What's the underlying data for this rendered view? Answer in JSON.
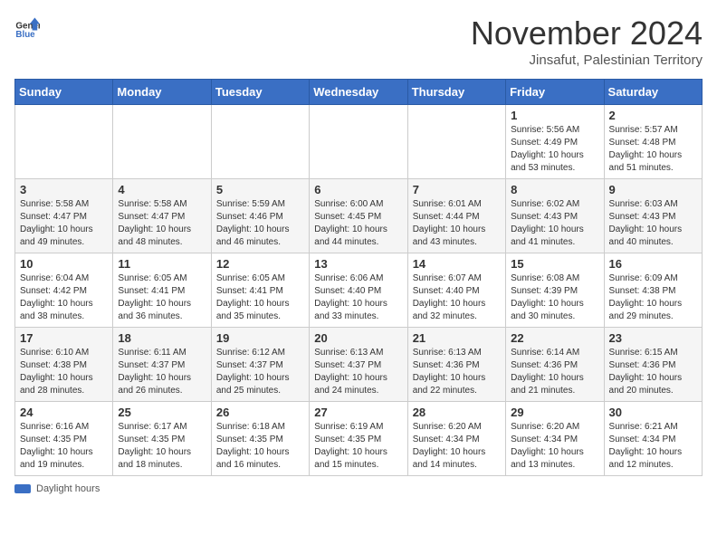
{
  "header": {
    "logo_general": "General",
    "logo_blue": "Blue",
    "month_title": "November 2024",
    "location": "Jinsafut, Palestinian Territory"
  },
  "days_of_week": [
    "Sunday",
    "Monday",
    "Tuesday",
    "Wednesday",
    "Thursday",
    "Friday",
    "Saturday"
  ],
  "weeks": [
    [
      {
        "day": "",
        "info": ""
      },
      {
        "day": "",
        "info": ""
      },
      {
        "day": "",
        "info": ""
      },
      {
        "day": "",
        "info": ""
      },
      {
        "day": "",
        "info": ""
      },
      {
        "day": "1",
        "info": "Sunrise: 5:56 AM\nSunset: 4:49 PM\nDaylight: 10 hours and 53 minutes."
      },
      {
        "day": "2",
        "info": "Sunrise: 5:57 AM\nSunset: 4:48 PM\nDaylight: 10 hours and 51 minutes."
      }
    ],
    [
      {
        "day": "3",
        "info": "Sunrise: 5:58 AM\nSunset: 4:47 PM\nDaylight: 10 hours and 49 minutes."
      },
      {
        "day": "4",
        "info": "Sunrise: 5:58 AM\nSunset: 4:47 PM\nDaylight: 10 hours and 48 minutes."
      },
      {
        "day": "5",
        "info": "Sunrise: 5:59 AM\nSunset: 4:46 PM\nDaylight: 10 hours and 46 minutes."
      },
      {
        "day": "6",
        "info": "Sunrise: 6:00 AM\nSunset: 4:45 PM\nDaylight: 10 hours and 44 minutes."
      },
      {
        "day": "7",
        "info": "Sunrise: 6:01 AM\nSunset: 4:44 PM\nDaylight: 10 hours and 43 minutes."
      },
      {
        "day": "8",
        "info": "Sunrise: 6:02 AM\nSunset: 4:43 PM\nDaylight: 10 hours and 41 minutes."
      },
      {
        "day": "9",
        "info": "Sunrise: 6:03 AM\nSunset: 4:43 PM\nDaylight: 10 hours and 40 minutes."
      }
    ],
    [
      {
        "day": "10",
        "info": "Sunrise: 6:04 AM\nSunset: 4:42 PM\nDaylight: 10 hours and 38 minutes."
      },
      {
        "day": "11",
        "info": "Sunrise: 6:05 AM\nSunset: 4:41 PM\nDaylight: 10 hours and 36 minutes."
      },
      {
        "day": "12",
        "info": "Sunrise: 6:05 AM\nSunset: 4:41 PM\nDaylight: 10 hours and 35 minutes."
      },
      {
        "day": "13",
        "info": "Sunrise: 6:06 AM\nSunset: 4:40 PM\nDaylight: 10 hours and 33 minutes."
      },
      {
        "day": "14",
        "info": "Sunrise: 6:07 AM\nSunset: 4:40 PM\nDaylight: 10 hours and 32 minutes."
      },
      {
        "day": "15",
        "info": "Sunrise: 6:08 AM\nSunset: 4:39 PM\nDaylight: 10 hours and 30 minutes."
      },
      {
        "day": "16",
        "info": "Sunrise: 6:09 AM\nSunset: 4:38 PM\nDaylight: 10 hours and 29 minutes."
      }
    ],
    [
      {
        "day": "17",
        "info": "Sunrise: 6:10 AM\nSunset: 4:38 PM\nDaylight: 10 hours and 28 minutes."
      },
      {
        "day": "18",
        "info": "Sunrise: 6:11 AM\nSunset: 4:37 PM\nDaylight: 10 hours and 26 minutes."
      },
      {
        "day": "19",
        "info": "Sunrise: 6:12 AM\nSunset: 4:37 PM\nDaylight: 10 hours and 25 minutes."
      },
      {
        "day": "20",
        "info": "Sunrise: 6:13 AM\nSunset: 4:37 PM\nDaylight: 10 hours and 24 minutes."
      },
      {
        "day": "21",
        "info": "Sunrise: 6:13 AM\nSunset: 4:36 PM\nDaylight: 10 hours and 22 minutes."
      },
      {
        "day": "22",
        "info": "Sunrise: 6:14 AM\nSunset: 4:36 PM\nDaylight: 10 hours and 21 minutes."
      },
      {
        "day": "23",
        "info": "Sunrise: 6:15 AM\nSunset: 4:36 PM\nDaylight: 10 hours and 20 minutes."
      }
    ],
    [
      {
        "day": "24",
        "info": "Sunrise: 6:16 AM\nSunset: 4:35 PM\nDaylight: 10 hours and 19 minutes."
      },
      {
        "day": "25",
        "info": "Sunrise: 6:17 AM\nSunset: 4:35 PM\nDaylight: 10 hours and 18 minutes."
      },
      {
        "day": "26",
        "info": "Sunrise: 6:18 AM\nSunset: 4:35 PM\nDaylight: 10 hours and 16 minutes."
      },
      {
        "day": "27",
        "info": "Sunrise: 6:19 AM\nSunset: 4:35 PM\nDaylight: 10 hours and 15 minutes."
      },
      {
        "day": "28",
        "info": "Sunrise: 6:20 AM\nSunset: 4:34 PM\nDaylight: 10 hours and 14 minutes."
      },
      {
        "day": "29",
        "info": "Sunrise: 6:20 AM\nSunset: 4:34 PM\nDaylight: 10 hours and 13 minutes."
      },
      {
        "day": "30",
        "info": "Sunrise: 6:21 AM\nSunset: 4:34 PM\nDaylight: 10 hours and 12 minutes."
      }
    ]
  ],
  "legend": {
    "daylight_label": "Daylight hours"
  }
}
